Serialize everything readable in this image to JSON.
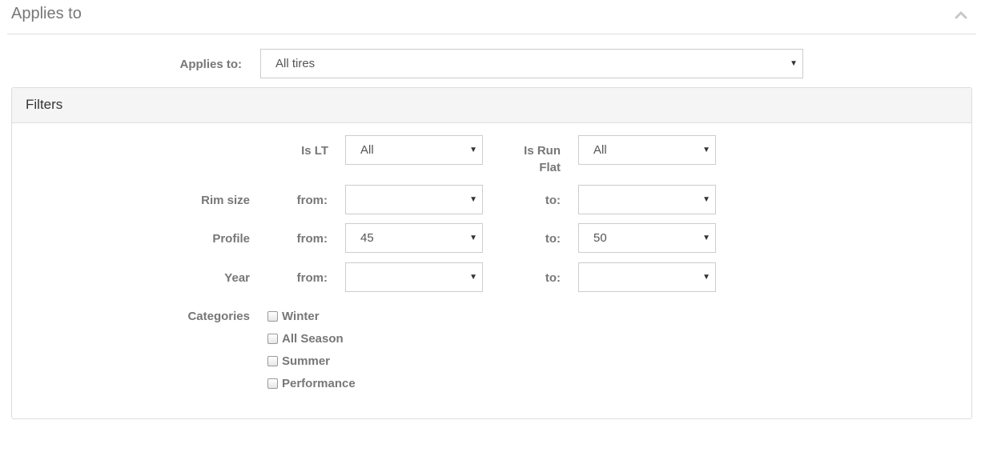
{
  "section": {
    "title": "Applies to",
    "applies_to_label": "Applies to:",
    "applies_to_value": "All tires"
  },
  "filters": {
    "title": "Filters",
    "is_lt": {
      "label": "Is LT",
      "value": "All"
    },
    "is_run_flat": {
      "label_line1": "Is Run",
      "label_line2": "Flat",
      "value": "All"
    },
    "from_label": "from:",
    "to_label": "to:",
    "rim_size": {
      "label": "Rim size",
      "from_value": "",
      "to_value": ""
    },
    "profile": {
      "label": "Profile",
      "from_value": "45",
      "to_value": "50"
    },
    "year": {
      "label": "Year",
      "from_value": "",
      "to_value": ""
    },
    "categories": {
      "label": "Categories",
      "items": [
        {
          "label": "Winter",
          "checked": false
        },
        {
          "label": "All Season",
          "checked": false
        },
        {
          "label": "Summer",
          "checked": false
        },
        {
          "label": "Performance",
          "checked": false
        }
      ]
    }
  },
  "icons": {
    "collapse": "chevron-up-icon",
    "dropdown": "caret-down-icon",
    "caret_glyph": "▼"
  },
  "colors": {
    "label": "#777777",
    "border": "#cccccc",
    "panel_header": "#f5f5f5"
  }
}
